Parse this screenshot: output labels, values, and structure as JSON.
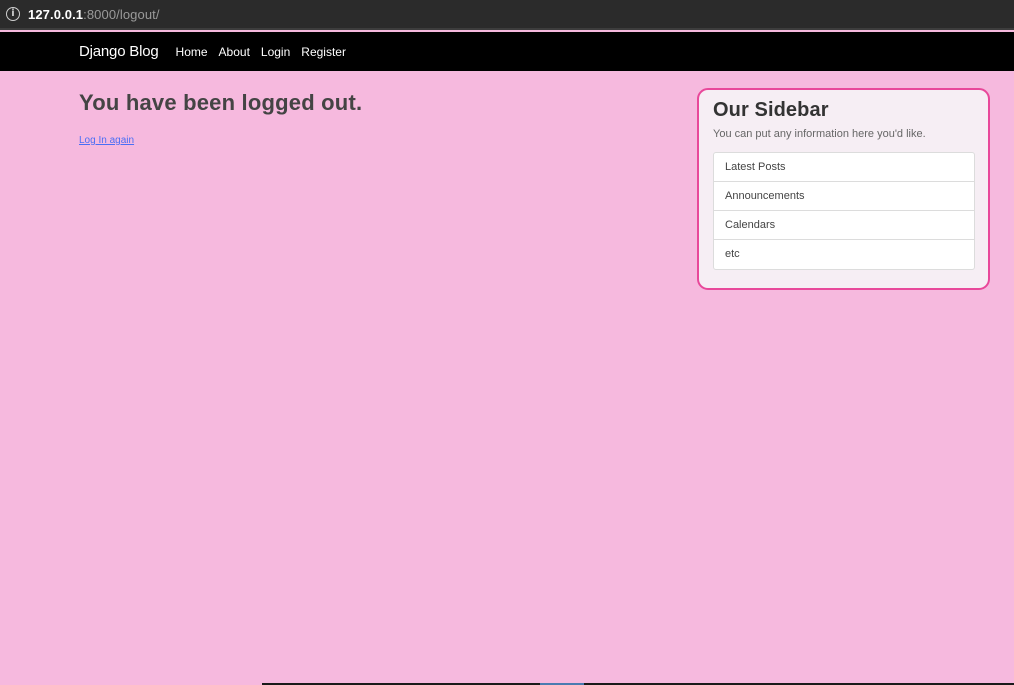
{
  "browser": {
    "url_host": "127.0.0.1",
    "url_rest": ":8000/logout/",
    "info_icon": "info-icon"
  },
  "navbar": {
    "brand": "Django Blog",
    "links": [
      "Home",
      "About",
      "Login",
      "Register"
    ]
  },
  "main": {
    "heading": "You have been logged out.",
    "login_again_link": "Log In again"
  },
  "sidebar": {
    "title": "Our Sidebar",
    "description": "You can put any information here you'd like.",
    "items": [
      "Latest Posts",
      "Announcements",
      "Calendars",
      "etc"
    ]
  },
  "colors": {
    "page_background": "#f6b9de",
    "navbar_background": "#000000",
    "sidebar_border": "#e8489a",
    "link": "#4a6ef5"
  }
}
